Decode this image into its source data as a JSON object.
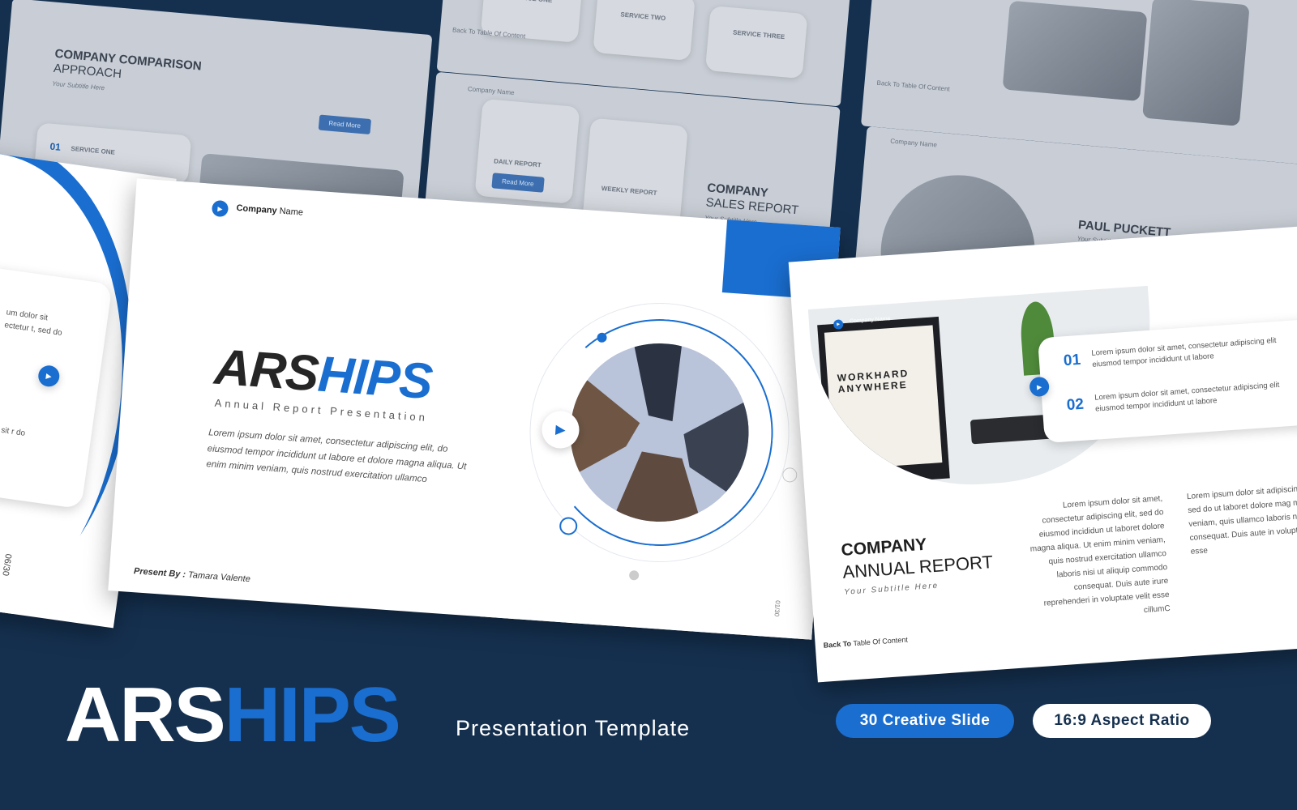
{
  "colors": {
    "background": "#15304f",
    "accent": "#1a6ed0",
    "white": "#ffffff"
  },
  "background_slides": {
    "comparison": {
      "title_bold": "COMPANY COMPARISON",
      "title_light": "APPROACH",
      "subtitle": "Your Subtitle Here",
      "button": "Read More",
      "num": "01",
      "service": "SERVICE ONE"
    },
    "services": {
      "items": [
        "SERVICE ONE",
        "SERVICE TWO",
        "SERVICE THREE"
      ],
      "back": "Back To Table Of Content"
    },
    "sales": {
      "brand": "Company Name",
      "items": [
        "DAILY REPORT",
        "WEEKLY REPORT"
      ],
      "button": "Read More",
      "title_bold": "COMPANY",
      "title_light": "SALES REPORT",
      "subtitle": "Your Subtitle Here"
    },
    "team": {
      "brand": "Company Name",
      "name": "PAUL PUCKETT",
      "subtitle": "Your Subtitle Here",
      "back": "Back To Table Of Content"
    }
  },
  "main_slide": {
    "brand_bold": "Company",
    "brand_light": "Name",
    "title_dark": "ARS",
    "title_accent": "HIPS",
    "subtitle": "Annual Report Presentation",
    "body": "Lorem ipsum dolor sit amet, consectetur adipiscing elit, do eiusmod tempor incididunt ut labore et dolore magna aliqua. Ut enim minim veniam, quis nostrud exercitation ullamco",
    "present_label": "Present By :",
    "presenter": "Tamara Valente",
    "page": "01/30"
  },
  "left_slide": {
    "text": "um dolor sit ectetur t, sed do",
    "text2": "lor sit r do",
    "page": "06/30"
  },
  "right_slide": {
    "brand": "Company Name",
    "laptop_text": "WORKHARD ANYWHERE",
    "items": [
      {
        "num": "01",
        "text": "Lorem ipsum dolor sit amet, consectetur adipiscing elit eiusmod tempor incididunt ut labore"
      },
      {
        "num": "02",
        "text": "Lorem ipsum dolor sit amet, consectetur adipiscing elit eiusmod tempor incididunt ut labore"
      }
    ],
    "title_bold": "COMPANY",
    "title_light": "ANNUAL REPORT",
    "subtitle": "Your Subtitle Here",
    "col1": "Lorem ipsum dolor sit amet, consectetur adipiscing elit, sed do eiusmod incididun ut laboret dolore magna aliqua. Ut enim minim veniam, quis nostrud exercitation ullamco laboris nisi ut aliquip commodo consequat. Duis aute irure reprehenderi in voluptate velit esse cillumC",
    "col2": "Lorem ipsum dolor sit adipiscing elit, sed do ut laboret dolore mag minim veniam, quis ullamco laboris nisi consequat. Duis aute in voluptate velit esse",
    "back_bold": "Back To",
    "back_light": "Table Of Content"
  },
  "footer": {
    "title_white": "ARS",
    "title_accent": "HIPS",
    "tagline": "Presentation Template",
    "badge1": "30 Creative Slide",
    "badge2": "16:9 Aspect Ratio"
  }
}
